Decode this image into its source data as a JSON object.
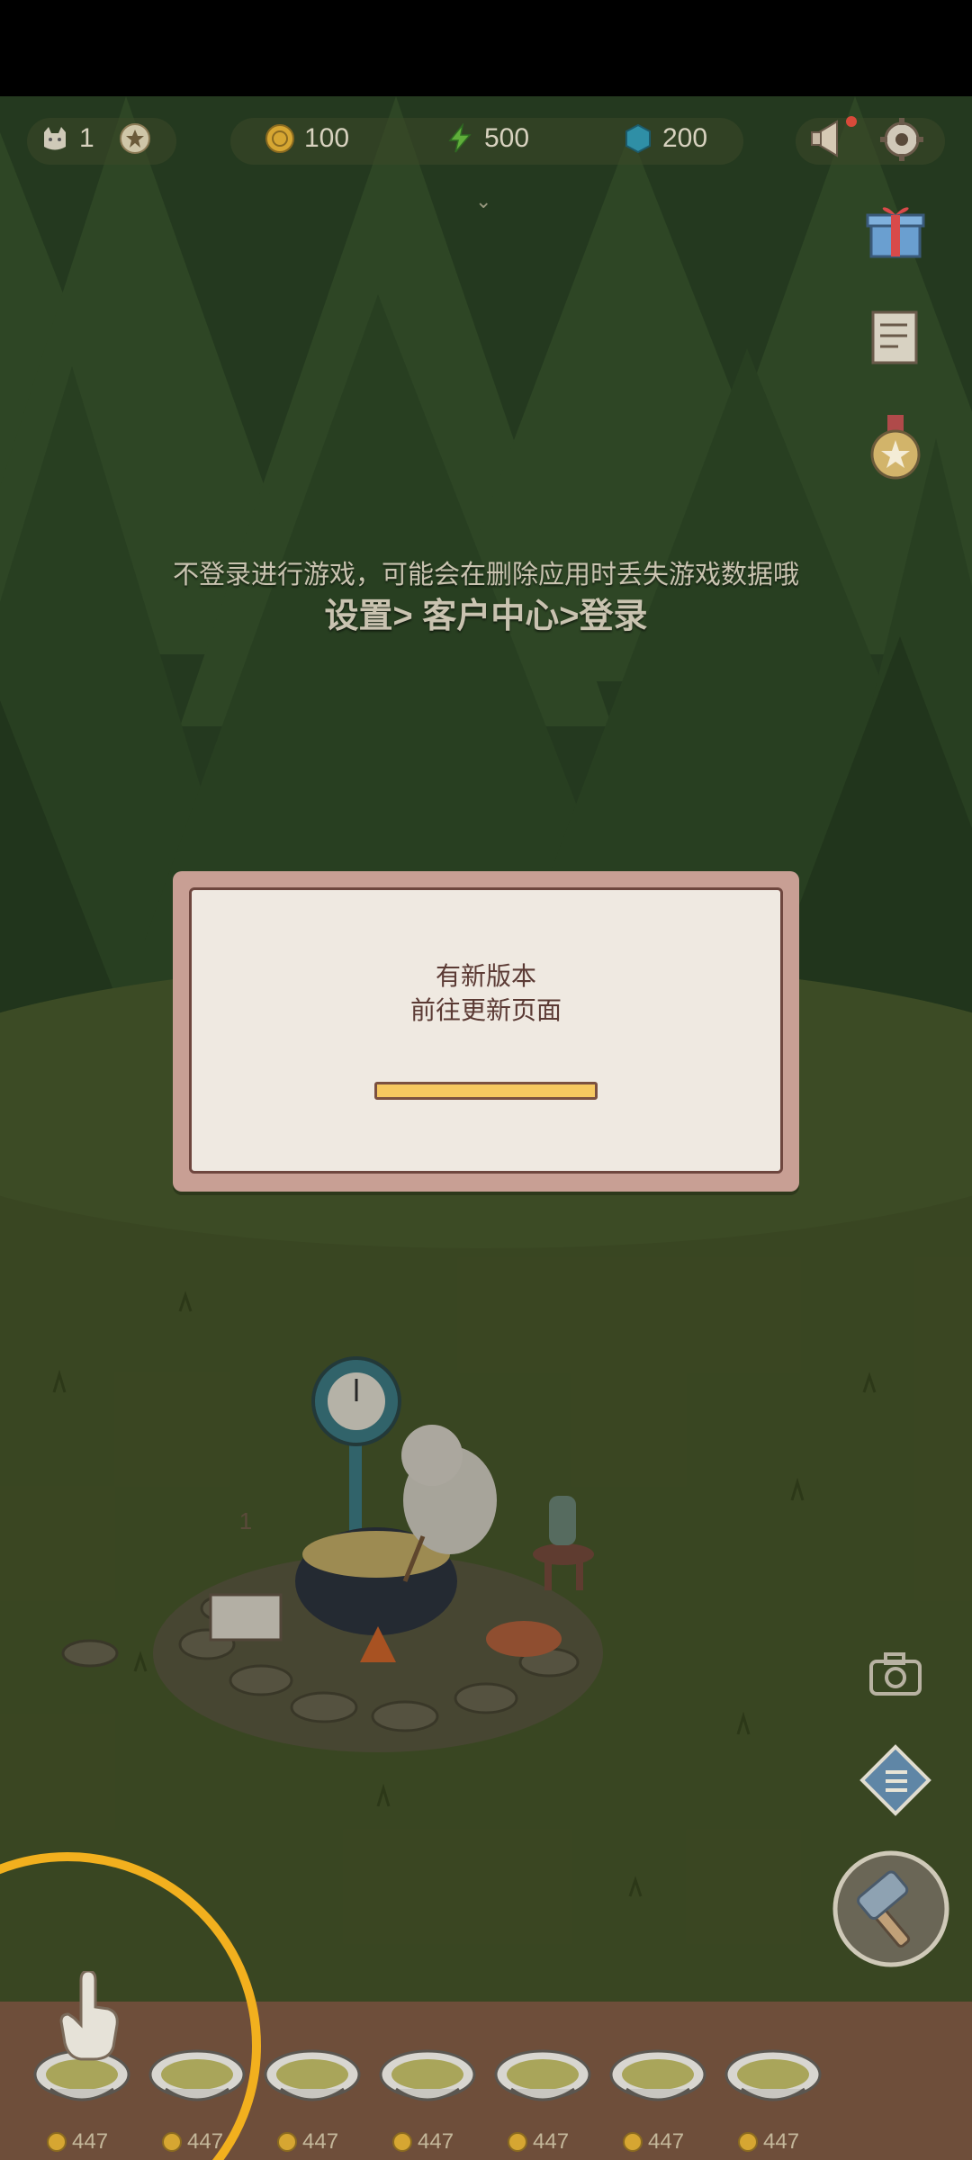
{
  "hud": {
    "cats_count": "1",
    "coins": "100",
    "energy": "500",
    "gems": "200"
  },
  "icons": {
    "cat": "cat-icon",
    "star_badge": "star-badge-icon",
    "coin": "coin-icon",
    "energy": "lightning-icon",
    "gem": "gem-icon",
    "announcement": "megaphone-icon",
    "settings": "gear-icon",
    "gift": "gift-icon",
    "notes": "notes-icon",
    "medal": "medal-icon",
    "camera": "camera-icon",
    "menu": "list-icon",
    "build": "hammer-icon"
  },
  "notice": {
    "line1": "不登录进行游戏，可能会在删除应用时丢失游戏数据哦",
    "line2": "设置> 客户中心>登录"
  },
  "dialog": {
    "line1": "有新版本",
    "line2": "前往更新页面",
    "progress": 1.0
  },
  "pot_sign": "1",
  "shelf": {
    "items": [
      {
        "price": "447"
      },
      {
        "price": "447"
      },
      {
        "price": "447"
      },
      {
        "price": "447"
      },
      {
        "price": "447"
      },
      {
        "price": "447"
      },
      {
        "price": "447"
      }
    ]
  },
  "colors": {
    "highlight_ring": "#f2b01e",
    "dialog_border": "#c89f94",
    "progress": "#f6c860"
  }
}
